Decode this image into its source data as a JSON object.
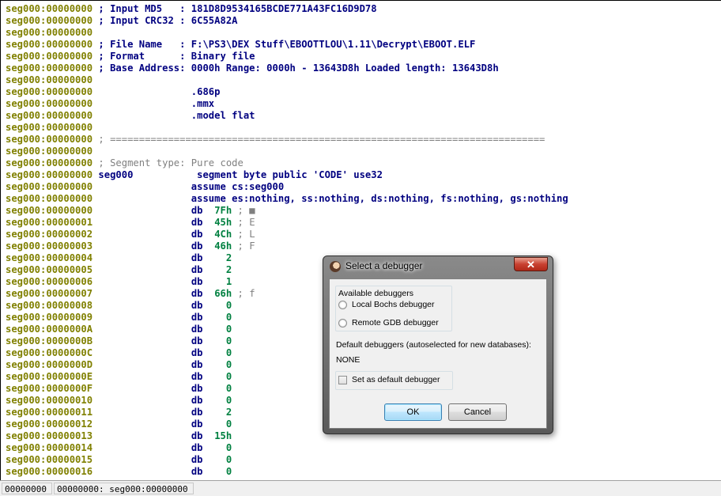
{
  "listing": {
    "lines": [
      {
        "addr": "seg000:00000000",
        "name": "",
        "text": " ; Input MD5   : 181D8D9534165BCDE771A43FC16D9D78",
        "style": "blue",
        "comment": ""
      },
      {
        "addr": "seg000:00000000",
        "name": "",
        "text": " ; Input CRC32 : 6C55A82A",
        "style": "blue",
        "comment": ""
      },
      {
        "addr": "seg000:00000000",
        "name": "",
        "text": "",
        "style": "blue",
        "comment": ""
      },
      {
        "addr": "seg000:00000000",
        "name": "",
        "text": " ; File Name   : F:\\PS3\\DEX Stuff\\EBOOTTLOU\\1.11\\Decrypt\\EBOOT.ELF",
        "style": "blue",
        "comment": ""
      },
      {
        "addr": "seg000:00000000",
        "name": "",
        "text": " ; Format      : Binary file",
        "style": "blue",
        "comment": ""
      },
      {
        "addr": "seg000:00000000",
        "name": "",
        "text": " ; Base Address: 0000h Range: 0000h - 13643D8h Loaded length: 13643D8h",
        "style": "blue",
        "comment": ""
      },
      {
        "addr": "seg000:00000000",
        "name": "",
        "text": "",
        "style": "blue",
        "comment": ""
      },
      {
        "addr": "seg000:00000000",
        "name": "",
        "text": "                 .686p",
        "style": "blue",
        "comment": ""
      },
      {
        "addr": "seg000:00000000",
        "name": "",
        "text": "                 .mmx",
        "style": "blue",
        "comment": ""
      },
      {
        "addr": "seg000:00000000",
        "name": "",
        "text": "                 .model flat",
        "style": "blue",
        "comment": ""
      },
      {
        "addr": "seg000:00000000",
        "name": "",
        "text": "",
        "style": "blue",
        "comment": ""
      },
      {
        "addr": "seg000:00000000",
        "name": "",
        "text": " ; ===========================================================================",
        "style": "grey",
        "comment": ""
      },
      {
        "addr": "seg000:00000000",
        "name": "",
        "text": "",
        "style": "blue",
        "comment": ""
      },
      {
        "addr": "seg000:00000000",
        "name": "",
        "text": " ; Segment type: Pure code",
        "style": "grey",
        "comment": ""
      },
      {
        "addr": "seg000:00000000",
        "name": " seg000",
        "text": "           segment byte public 'CODE' use32",
        "style": "blue",
        "comment": ""
      },
      {
        "addr": "seg000:00000000",
        "name": "",
        "text": "                 assume cs:seg000",
        "style": "blue",
        "comment": ""
      },
      {
        "addr": "seg000:00000000",
        "name": "",
        "text": "                 assume es:nothing, ss:nothing, ds:nothing, fs:nothing, gs:nothing",
        "style": "blue",
        "comment": ""
      },
      {
        "addr": "seg000:00000000",
        "db": "7Fh",
        "comment": " ; ■"
      },
      {
        "addr": "seg000:00000001",
        "db": "45h",
        "comment": " ; E"
      },
      {
        "addr": "seg000:00000002",
        "db": "4Ch",
        "comment": " ; L"
      },
      {
        "addr": "seg000:00000003",
        "db": "46h",
        "comment": " ; F"
      },
      {
        "addr": "seg000:00000004",
        "db": "  2",
        "comment": ""
      },
      {
        "addr": "seg000:00000005",
        "db": "  2",
        "comment": ""
      },
      {
        "addr": "seg000:00000006",
        "db": "  1",
        "comment": ""
      },
      {
        "addr": "seg000:00000007",
        "db": "66h",
        "comment": " ; f"
      },
      {
        "addr": "seg000:00000008",
        "db": "  0",
        "comment": ""
      },
      {
        "addr": "seg000:00000009",
        "db": "  0",
        "comment": ""
      },
      {
        "addr": "seg000:0000000A",
        "db": "  0",
        "comment": ""
      },
      {
        "addr": "seg000:0000000B",
        "db": "  0",
        "comment": ""
      },
      {
        "addr": "seg000:0000000C",
        "db": "  0",
        "comment": ""
      },
      {
        "addr": "seg000:0000000D",
        "db": "  0",
        "comment": ""
      },
      {
        "addr": "seg000:0000000E",
        "db": "  0",
        "comment": ""
      },
      {
        "addr": "seg000:0000000F",
        "db": "  0",
        "comment": ""
      },
      {
        "addr": "seg000:00000010",
        "db": "  0",
        "comment": ""
      },
      {
        "addr": "seg000:00000011",
        "db": "  2",
        "comment": ""
      },
      {
        "addr": "seg000:00000012",
        "db": "  0",
        "comment": ""
      },
      {
        "addr": "seg000:00000013",
        "db": "15h",
        "comment": ""
      },
      {
        "addr": "seg000:00000014",
        "db": "  0",
        "comment": ""
      },
      {
        "addr": "seg000:00000015",
        "db": "  0",
        "comment": ""
      },
      {
        "addr": "seg000:00000016",
        "db": "  0",
        "comment": ""
      }
    ],
    "db_mnemonic": "db"
  },
  "statusbar": {
    "cell1": "00000000",
    "cell2": "00000000: seg000:00000000"
  },
  "dialog": {
    "title": "Select a debugger",
    "close_label": "✕",
    "group_label": "Available debuggers",
    "options": [
      "Local Bochs debugger",
      "Remote GDB debugger"
    ],
    "default_label": "Default debuggers (autoselected for new databases):",
    "default_value": "NONE",
    "checkbox_label": "Set as default debugger",
    "ok_label": "OK",
    "cancel_label": "Cancel"
  },
  "colors": {
    "address": "#808000",
    "code": "#000080",
    "comment": "#808080",
    "number": "#008040"
  }
}
